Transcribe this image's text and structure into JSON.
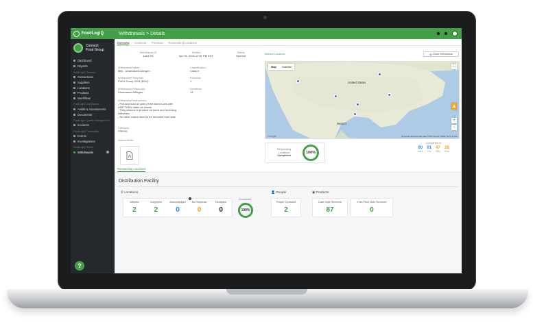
{
  "app": {
    "brand": "FoodLogiQ",
    "window_title": "Withdrawals > Details"
  },
  "colors": {
    "brand": "#43a047",
    "sidebar": "#25282c",
    "blue": "#1e88e5",
    "orange": "#f59e0b"
  },
  "org": {
    "name_line1": "Connect",
    "name_line2": "Food Group"
  },
  "sidebar": {
    "items_top": [
      {
        "label": "Dashboard",
        "icon": "dashboard-icon"
      },
      {
        "label": "Reports",
        "icon": "reports-icon"
      }
    ],
    "section_network": "FoodLogiQ Connect",
    "items_network": [
      {
        "label": "Connections",
        "icon": "connections-icon"
      },
      {
        "label": "Suppliers",
        "icon": "suppliers-icon"
      },
      {
        "label": "Locations",
        "icon": "locations-icon"
      },
      {
        "label": "Products",
        "icon": "products-icon"
      },
      {
        "label": "Workflows",
        "icon": "workflows-icon"
      }
    ],
    "section_compliance": "FoodLogiQ Compliance",
    "items_compliance": [
      {
        "label": "Audits & Assessments",
        "icon": "audits-icon"
      },
      {
        "label": "Documents",
        "icon": "documents-icon"
      }
    ],
    "section_quality": "FoodLogiQ Quality Management",
    "items_quality": [
      {
        "label": "Incidents",
        "icon": "incidents-icon"
      }
    ],
    "section_trace": "FoodLogiQ Traceability",
    "items_trace": [
      {
        "label": "Events",
        "icon": "events-icon"
      },
      {
        "label": "Investigations",
        "icon": "investigations-icon"
      }
    ],
    "section_recall": "FoodLogiQ Recall",
    "items_recall": [
      {
        "label": "Withdrawals",
        "icon": "withdrawals-icon"
      }
    ]
  },
  "tabs": [
    "Overview",
    "Contacts",
    "Products",
    "Responding Locations"
  ],
  "details": {
    "withdrawal_id_label": "Withdrawal ID",
    "withdrawal_id": "1623-FA",
    "started_label": "Started",
    "started": "Apr 04, 2023 12:51 PM EDT",
    "status_label": "Status",
    "status": "Opened",
    "name_label": "Withdrawal Name",
    "name": "Milk - Undeclared Allergen",
    "classification_label": "Classification",
    "classification": "Class II",
    "template_label": "Withdrawal Template",
    "template": "Pull & Dump 2023 (BSO)",
    "products_label": "Products",
    "products": "1",
    "reason_label": "Withdrawal Reason(s)",
    "reason": "Undeclared Allergen",
    "locations_label": "Locations",
    "locations": "13",
    "instructions_label": "Withdrawal Instructions",
    "instructions_1": "- Pull and hold all units of the listed Lot/s with",
    "instructions_2": "  USE THRU dates as shown",
    "instructions_3": "- Thin persons to product on hand and incoming",
    "instructions_4": "  deliveries",
    "instructions_5": "- No other codes need to be removed from sale",
    "category_label": "Category",
    "category": "FRESH",
    "attachments_label": "Attachments"
  },
  "map": {
    "section_label": "Affected Locations",
    "close_button": "Close Withdrawal",
    "toggle_map": "Map",
    "toggle_satellite": "Satellite",
    "label_united_states": "United States",
    "label_mexico": "Mexico",
    "google": "Google",
    "footer": "Keyboard shortcuts   Map data ©2023 Google, INEGI   Terms of Use"
  },
  "responding": {
    "label_1": "Responding",
    "label_2": "Locations",
    "label_3": "Completed",
    "percent": "100%"
  },
  "countdown": {
    "label": "Completed In",
    "days": "00",
    "hrs": "01",
    "mins": "47",
    "secs": "28",
    "days_label": "Days",
    "hrs_label": "Hrs",
    "mins_label": "Mins",
    "secs_label": "Secs"
  },
  "responding_tab": "Responding Locations",
  "facility": {
    "title": "Distribution Facility",
    "locations_head": "Locations",
    "stats": [
      {
        "label": "Affected",
        "value": "2"
      },
      {
        "label": "Completed",
        "value": "2"
      },
      {
        "label": "Acknowledged",
        "value": "0"
      },
      {
        "label": "No Response",
        "value": "0"
      },
      {
        "label": "Escalated",
        "value": "0"
      }
    ],
    "completed_label": "Completed",
    "completed_percent": "100%",
    "completed_fraction": 1.0,
    "people_head": "People",
    "people_contacted_label": "People Contacted",
    "people_contacted": "2",
    "products_head": "Products",
    "case_units_label": "Case Units Removed",
    "case_units": "87",
    "inner_pack_label": "Inner-Pack Units Removed",
    "inner_pack": "0"
  }
}
